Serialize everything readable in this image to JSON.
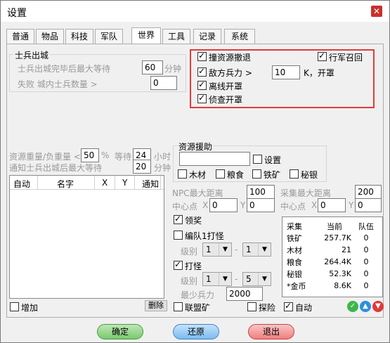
{
  "window": {
    "title": "设置"
  },
  "tabs": [
    "普通",
    "物品",
    "科技",
    "军队",
    "世界",
    "工具",
    "记录",
    "系统"
  ],
  "soldier": {
    "group_title": "士兵出城",
    "row1_label": "士兵出城完毕后最大等待",
    "row1_value": "60",
    "row1_unit": "分钟",
    "row2_label": "失败 城内士兵数量 >",
    "row2_value": "0"
  },
  "flags": {
    "resource_retreat": "撞资源撤退",
    "march_recall": "行军召回",
    "enemy_troops": "敌方兵力 >",
    "enemy_value": "10",
    "enemy_unit": "K，开罩",
    "offline_shield": "离线开罩",
    "scout_shield": "侦查开罩"
  },
  "weight": {
    "label1": "资源重量/负重量 <",
    "value1": "50",
    "unit1": "%",
    "wait_label": "等待",
    "wait_value": "24",
    "wait_unit": "小时",
    "label2": "通知士兵出城后最大等待",
    "value2": "20",
    "unit2": "分钟"
  },
  "list": {
    "columns": [
      "自动",
      "名字",
      "X",
      "Y",
      "通知"
    ],
    "add_label": "增加",
    "delete_label": "删除"
  },
  "aid": {
    "group_title": "资源援助",
    "settings_label": "设置",
    "wood": "木材",
    "food": "粮食",
    "iron": "铁矿",
    "silver": "秘银"
  },
  "npc": {
    "label": "NPC最大距离",
    "value": "100",
    "center_label": "中心点",
    "x_label": "X",
    "x_value": "0",
    "y_label": "Y",
    "y_value": "0"
  },
  "gather": {
    "label": "采集最大距离",
    "value": "200",
    "center_label": "中心点",
    "x_label": "X",
    "x_value": "0",
    "y_label": "Y",
    "y_value": "0"
  },
  "reward_label": "领奖",
  "team_monster": {
    "label": "编队1打怪",
    "level_label": "级别",
    "from": "1",
    "to": "1"
  },
  "monster": {
    "label": "打怪",
    "level_label": "级别",
    "from": "1",
    "to": "5",
    "min_label": "最少兵力",
    "min_value": "2000"
  },
  "resources": {
    "headers": [
      "采集",
      "当前",
      "队伍"
    ],
    "rows": [
      {
        "name": "铁矿",
        "current": "257.7K",
        "team": "0"
      },
      {
        "name": "木材",
        "current": "21",
        "team": "0"
      },
      {
        "name": "粮食",
        "current": "264.4K",
        "team": "0"
      },
      {
        "name": "秘银",
        "current": "52.3K",
        "team": "0"
      },
      {
        "name": "*金币",
        "current": "8.6K",
        "team": "0"
      }
    ]
  },
  "alliance_mine": "联盟矿",
  "explore": "探险",
  "auto": "自动",
  "buttons": {
    "ok": "确定",
    "restore": "还原",
    "exit": "退出"
  },
  "colors": {
    "ok": "#3fb64a",
    "restore": "#2c8fe0",
    "exit": "#e03a3a",
    "highlight": "#e23a3a"
  }
}
